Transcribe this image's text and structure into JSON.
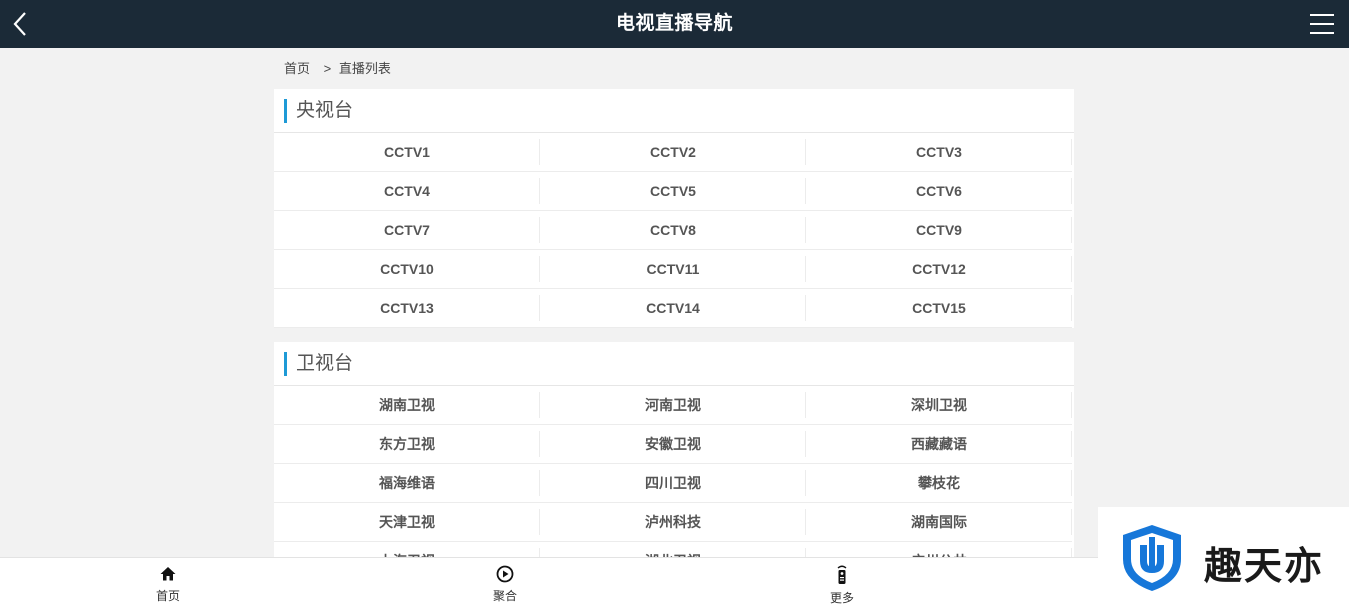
{
  "header": {
    "title": "电视直播导航"
  },
  "breadcrumb": {
    "home": "首页",
    "separator": ">",
    "current": "直播列表"
  },
  "sections": [
    {
      "title": "央视台",
      "channels": [
        "CCTV1",
        "CCTV2",
        "CCTV3",
        "CCTV4",
        "CCTV5",
        "CCTV6",
        "CCTV7",
        "CCTV8",
        "CCTV9",
        "CCTV10",
        "CCTV11",
        "CCTV12",
        "CCTV13",
        "CCTV14",
        "CCTV15"
      ]
    },
    {
      "title": "卫视台",
      "channels": [
        "湖南卫视",
        "河南卫视",
        "深圳卫视",
        "东方卫视",
        "安徽卫视",
        "西藏藏语",
        "福海维语",
        "四川卫视",
        "攀枝花",
        "天津卫视",
        "泸州科技",
        "湖南国际",
        "上海卫视",
        "湖北卫视",
        "广州公共"
      ]
    }
  ],
  "bottom_nav": [
    {
      "label": "首页",
      "icon": "home-icon"
    },
    {
      "label": "聚合",
      "icon": "play-circle-icon"
    },
    {
      "label": "更多",
      "icon": "remote-icon"
    }
  ],
  "watermark": {
    "text": "趣天亦",
    "logo": "shield-logo-icon"
  },
  "colors": {
    "header_bg": "#1b2a37",
    "accent": "#1e9ad6",
    "page_bg": "#f2f2f2"
  }
}
